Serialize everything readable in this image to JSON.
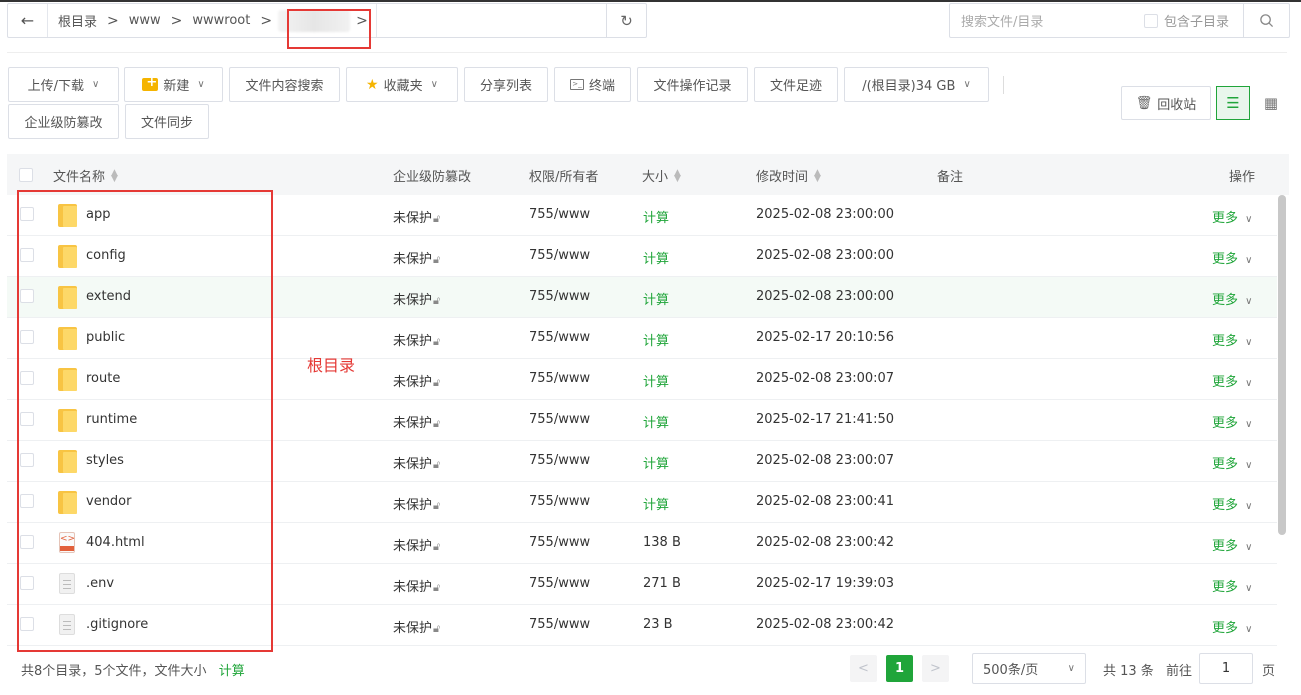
{
  "address_bar": {
    "back": "←",
    "crumbs": [
      "根目录",
      "www",
      "wwwroot"
    ],
    "separator": ">",
    "refresh": "↻"
  },
  "search": {
    "placeholder": "搜索文件/目录",
    "include_subdir_label": "包含子目录"
  },
  "toolbar": {
    "upload_download": "上传/下载",
    "new": "新建",
    "content_search": "文件内容搜索",
    "favorites": "收藏夹",
    "share_list": "分享列表",
    "terminal": "终端",
    "file_ops_log": "文件操作记录",
    "file_footprint": "文件足迹",
    "disk": "/(根目录)34 GB",
    "tamper_protect": "企业级防篡改",
    "file_sync": "文件同步",
    "recycle_bin": "回收站"
  },
  "table": {
    "headers": {
      "name": "文件名称",
      "tamper": "企业级防篡改",
      "perm": "权限/所有者",
      "size": "大小",
      "mtime": "修改时间",
      "note": "备注",
      "ops": "操作"
    },
    "rows": [
      {
        "name": "app",
        "type": "folder",
        "tamper": "未保护",
        "perm": "755/www",
        "size": "计算",
        "mtime": "2025-02-08 23:00:00",
        "more": "更多"
      },
      {
        "name": "config",
        "type": "folder",
        "tamper": "未保护",
        "perm": "755/www",
        "size": "计算",
        "mtime": "2025-02-08 23:00:00",
        "more": "更多"
      },
      {
        "name": "extend",
        "type": "folder",
        "tamper": "未保护",
        "perm": "755/www",
        "size": "计算",
        "mtime": "2025-02-08 23:00:00",
        "more": "更多"
      },
      {
        "name": "public",
        "type": "folder",
        "tamper": "未保护",
        "perm": "755/www",
        "size": "计算",
        "mtime": "2025-02-17 20:10:56",
        "more": "更多"
      },
      {
        "name": "route",
        "type": "folder",
        "tamper": "未保护",
        "perm": "755/www",
        "size": "计算",
        "mtime": "2025-02-08 23:00:07",
        "more": "更多"
      },
      {
        "name": "runtime",
        "type": "folder",
        "tamper": "未保护",
        "perm": "755/www",
        "size": "计算",
        "mtime": "2025-02-17 21:41:50",
        "more": "更多"
      },
      {
        "name": "styles",
        "type": "folder",
        "tamper": "未保护",
        "perm": "755/www",
        "size": "计算",
        "mtime": "2025-02-08 23:00:07",
        "more": "更多"
      },
      {
        "name": "vendor",
        "type": "folder",
        "tamper": "未保护",
        "perm": "755/www",
        "size": "计算",
        "mtime": "2025-02-08 23:00:41",
        "more": "更多"
      },
      {
        "name": "404.html",
        "type": "html",
        "tamper": "未保护",
        "perm": "755/www",
        "size": "138 B",
        "mtime": "2025-02-08 23:00:42",
        "more": "更多"
      },
      {
        "name": ".env",
        "type": "file",
        "tamper": "未保护",
        "perm": "755/www",
        "size": "271 B",
        "mtime": "2025-02-17 19:39:03",
        "more": "更多"
      },
      {
        "name": ".gitignore",
        "type": "file",
        "tamper": "未保护",
        "perm": "755/www",
        "size": "23 B",
        "mtime": "2025-02-08 23:00:42",
        "more": "更多"
      }
    ]
  },
  "annotation": {
    "label": "根目录",
    "color": "#e53935"
  },
  "footer": {
    "summary": "共8个目录，5个文件，文件大小",
    "calc": "计算",
    "prev": "<",
    "current_page": "1",
    "next": ">",
    "page_size": "500条/页",
    "total": "共 13 条",
    "goto_label": "前往",
    "goto_value": "1",
    "page_suffix": "页"
  },
  "colors": {
    "accent": "#20a53a",
    "folder": "#f8c443"
  }
}
